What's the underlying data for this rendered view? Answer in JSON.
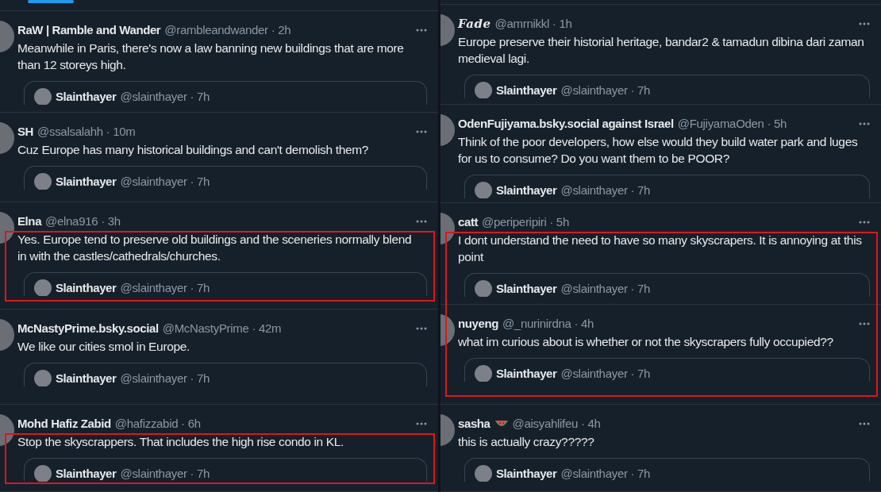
{
  "columns": [
    {
      "tab_indicator": true,
      "tweets": [
        {
          "name": "RaW | Ramble and Wander",
          "fancy_name": false,
          "meta": "@rambleandwander · 2h",
          "text": "Meanwhile in Paris, there's now a law banning new buildings that are more than 12 storeys high.",
          "highlighted": false,
          "emoji": false,
          "quote": {
            "name": "Slainthayer",
            "meta": "@slainthayer · 7h"
          }
        },
        {
          "name": "SH",
          "fancy_name": false,
          "meta": "@ssalsalahh · 10m",
          "text": "Cuz Europe has many historical buildings and can't demolish them?",
          "highlighted": false,
          "emoji": false,
          "quote": {
            "name": "Slainthayer",
            "meta": "@slainthayer · 7h"
          }
        },
        {
          "name": "Elna",
          "fancy_name": false,
          "meta": "@elna916 · 3h",
          "text": "Yes. Europe tend to preserve old buildings and the sceneries normally blend in with the castles/cathedrals/churches.",
          "highlighted": true,
          "emoji": false,
          "quote": {
            "name": "Slainthayer",
            "meta": "@slainthayer · 7h"
          }
        },
        {
          "name": "McNastyPrime.bsky.social",
          "fancy_name": false,
          "meta": "@McNastyPrime · 42m",
          "text": "We like our cities smol in Europe.",
          "highlighted": false,
          "emoji": false,
          "quote": {
            "name": "Slainthayer",
            "meta": "@slainthayer · 7h"
          }
        },
        {
          "name": "Mohd Hafiz Zabid",
          "fancy_name": false,
          "meta": "@hafizzabid · 6h",
          "text": "Stop the skyscrappers. That includes the high rise condo in KL.",
          "highlighted": true,
          "emoji": false,
          "quote": {
            "name": "Slainthayer",
            "meta": "@slainthayer · 7h"
          }
        }
      ]
    },
    {
      "tab_indicator": false,
      "tweets": [
        {
          "name": "Fade",
          "fancy_name": true,
          "meta": "@amrnikkl · 1h",
          "text": "Europe preserve their historial heritage, bandar2 & tamadun dibina dari zaman medieval lagi.",
          "highlighted": false,
          "emoji": false,
          "quote": {
            "name": "Slainthayer",
            "meta": "@slainthayer · 7h"
          }
        },
        {
          "name": "OdenFujiyama.bsky.social against Israel",
          "fancy_name": false,
          "meta": "@FujiyamaOden · 5h",
          "text": "Think of the poor developers, how else would they build water park and luges for us to consume? Do you want them to be POOR?",
          "highlighted": false,
          "emoji": false,
          "quote": {
            "name": "Slainthayer",
            "meta": "@slainthayer · 7h"
          }
        },
        {
          "name": "catt",
          "fancy_name": false,
          "meta": "@periperipiri · 5h",
          "text": "I dont understand the need to have so many skyscrapers. It is annoying at this point",
          "highlighted": true,
          "emoji": false,
          "quote": {
            "name": "Slainthayer",
            "meta": "@slainthayer · 7h"
          }
        },
        {
          "name": "nuyeng",
          "fancy_name": false,
          "meta": "@_nurinirdna · 4h",
          "text": "what im curious about is whether or not the skyscrapers fully occupied??",
          "highlighted": true,
          "emoji": false,
          "quote": {
            "name": "Slainthayer",
            "meta": "@slainthayer · 7h"
          }
        },
        {
          "name": "sasha",
          "fancy_name": false,
          "meta": "@aisyahlifeu · 4h",
          "text": "this is actually crazy?????",
          "highlighted": false,
          "emoji": true,
          "quote": {
            "name": "Slainthayer",
            "meta": "@slainthayer · 7h"
          }
        }
      ]
    }
  ]
}
